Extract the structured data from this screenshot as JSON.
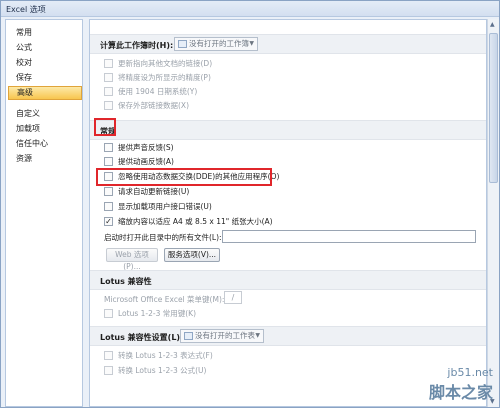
{
  "window": {
    "title": "Excel 选项"
  },
  "sidebar": {
    "items": [
      {
        "label": "常用"
      },
      {
        "label": "公式"
      },
      {
        "label": "校对"
      },
      {
        "label": "保存"
      },
      {
        "label": "高级",
        "active": true
      },
      {
        "label": "自定义"
      },
      {
        "label": "加载项"
      },
      {
        "label": "信任中心"
      },
      {
        "label": "资源"
      }
    ]
  },
  "calc_section": {
    "label": "计算此工作簿时(H):",
    "workbook_select": "没有打开的工作簿",
    "options": [
      {
        "label": "更新指向其他文档的链接(D)",
        "checked": false
      },
      {
        "label": "将精度设为所显示的精度(P)",
        "checked": false
      },
      {
        "label": "使用 1904 日期系统(Y)",
        "checked": false
      },
      {
        "label": "保存外部链接数据(X)",
        "checked": false
      }
    ]
  },
  "general_section": {
    "label": "常规",
    "options": [
      {
        "label": "提供声音反馈(S)",
        "checked": false
      },
      {
        "label": "提供动画反馈(A)",
        "checked": false
      },
      {
        "label": "忽略使用动态数据交换(DDE)的其他应用程序(O)",
        "checked": false,
        "highlighted": true
      },
      {
        "label": "请求自动更新链接(U)",
        "checked": false
      },
      {
        "label": "显示加载项用户接口错误(U)",
        "checked": false
      },
      {
        "label": "缩放内容以适应 A4 或 8.5 x 11\" 纸张大小(A)",
        "checked": true
      }
    ],
    "startup_label": "启动时打开此目录中的所有文件(L):",
    "startup_value": "",
    "web_options_button": "Web 选项(P)...",
    "service_options_button": "服务选项(V)..."
  },
  "lotus_compat": {
    "label": "Lotus 兼容性",
    "menu_key_label": "Microsoft Office Excel 菜单键(M):",
    "menu_key_value": "/",
    "options": [
      {
        "label": "Lotus 1-2-3 常用键(K)",
        "checked": false
      }
    ]
  },
  "lotus_settings": {
    "label": "Lotus 兼容性设置(L):",
    "worksheet_select": "没有打开的工作表",
    "options": [
      {
        "label": "转换 Lotus 1-2-3 表达式(F)",
        "checked": false
      },
      {
        "label": "转换 Lotus 1-2-3 公式(U)",
        "checked": false
      }
    ]
  },
  "watermark": {
    "url": "jb51.net",
    "cn_text": "脚本之家"
  }
}
